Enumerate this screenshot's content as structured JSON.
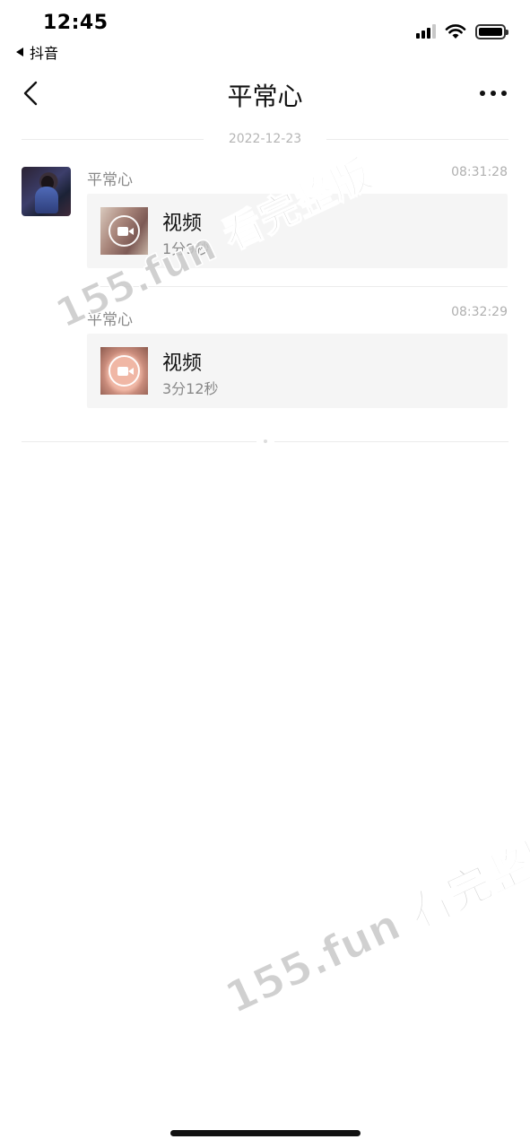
{
  "status_bar": {
    "time": "12:45",
    "back_app": "抖音",
    "icons": [
      "cellular-signal-icon",
      "wifi-icon",
      "battery-icon"
    ]
  },
  "nav": {
    "title": "平常心",
    "back_icon": "chevron-left-icon",
    "more_icon": "more-dots-icon"
  },
  "date_divider": "2022-12-23",
  "messages": [
    {
      "sender": "平常心",
      "time": "08:31:28",
      "type_label": "视频",
      "duration": "1分9秒"
    },
    {
      "sender": "平常心",
      "time": "08:32:29",
      "type_label": "视频",
      "duration": "3分12秒"
    }
  ],
  "watermarks": [
    "155.fun 看完整版",
    "155.fun 看完整版"
  ],
  "colors": {
    "card_bg": "#f5f5f5",
    "secondary_text": "#8a8a8a",
    "divider": "#ececec"
  }
}
